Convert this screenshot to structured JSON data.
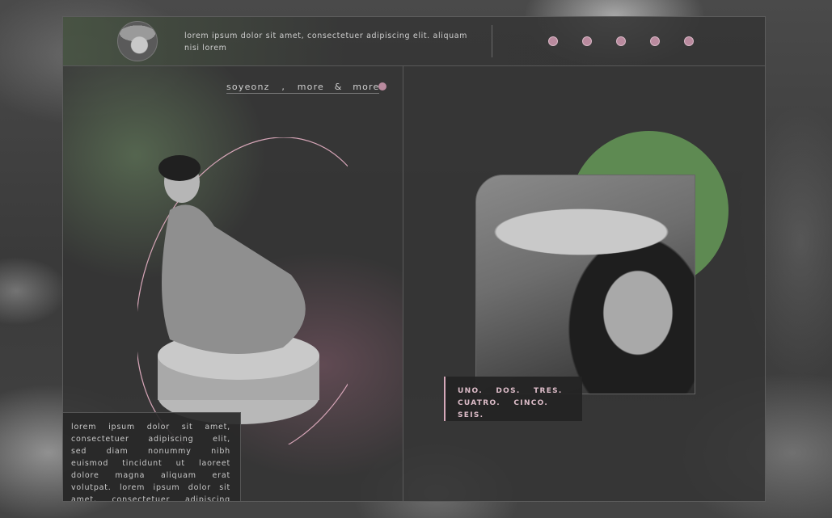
{
  "header": {
    "intro_text": "lorem ipsum dolor sit amet, consectetuer adipiscing elit. aliquam nisi lorem",
    "dots": [
      "dot-1",
      "dot-2",
      "dot-3",
      "dot-4",
      "dot-5"
    ]
  },
  "nav": {
    "item1": "soyeonz",
    "sep": " , ",
    "item2": "more",
    "amp": " & ",
    "item3": "more"
  },
  "left": {
    "body_text": "lorem ipsum dolor sit amet, consectetuer adipiscing elit, sed diam nonummy nibh euismod tincidunt ut laoreet dolore magna aliquam erat volutpat. lorem ipsum dolor sit amet, consectetuer adipiscing elit, sed diam nonummy nibh euismod tincidunt ut"
  },
  "right": {
    "row1": [
      "UNO.",
      "DOS.",
      "TRES."
    ],
    "row2": [
      "CUATRO.",
      "CINCO.",
      "SEIS."
    ]
  },
  "colors": {
    "accent_pink": "#b98a9e",
    "accent_green": "#5e8a52",
    "panel": "#343434"
  }
}
